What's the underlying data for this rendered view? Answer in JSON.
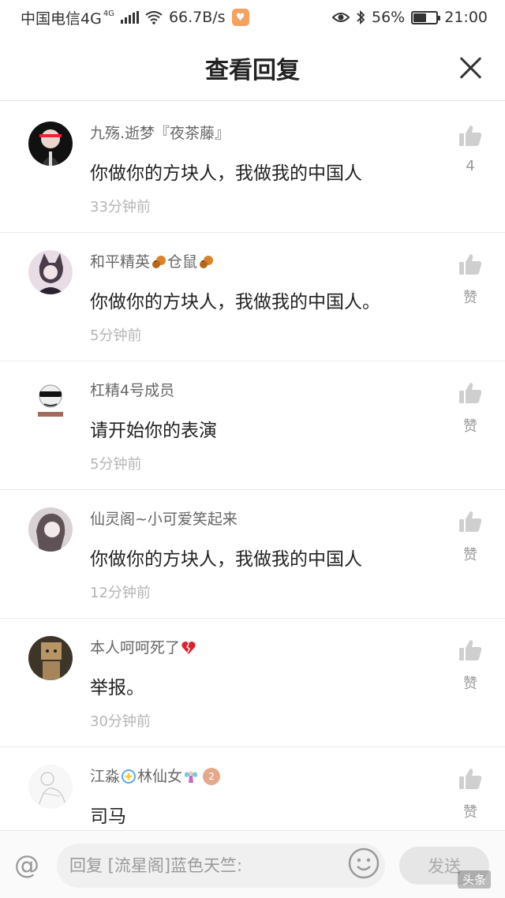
{
  "status_bar": {
    "carrier": "中国电信4G",
    "network_badge": "4G",
    "speed": "66.7B/s",
    "battery_level": "56%",
    "battery_fraction": 0.56,
    "time": "21:00"
  },
  "header": {
    "title": "查看回复"
  },
  "replies": [
    {
      "user_prefix": "九殇.逝梦『夜茶藤』",
      "user_suffix": "",
      "content": "你做你的方块人，我做我的中国人",
      "time": "33分钟前",
      "like_label": "4",
      "avatar_color": "#1a1a1a"
    },
    {
      "user_prefix": "和平精英",
      "user_mid": "仓鼠",
      "user_suffix": "",
      "content": "你做你的方块人，我做我的中国人。",
      "time": "5分钟前",
      "like_label": "赞",
      "avatar_color": "#c9b6c6"
    },
    {
      "user_prefix": "杠精4号成员",
      "user_suffix": "",
      "content": "请开始你的表演",
      "time": "5分钟前",
      "like_label": "赞",
      "avatar_color": "#ffffff"
    },
    {
      "user_prefix": "仙灵阁~小可爱笑起来",
      "user_suffix": "",
      "content": "你做你的方块人，我做我的中国人",
      "time": "12分钟前",
      "like_label": "赞",
      "avatar_color": "#8f7d80"
    },
    {
      "user_prefix": "本人呵呵死了",
      "user_suffix": "",
      "content": "举报。",
      "time": "30分钟前",
      "like_label": "赞",
      "avatar_color": "#6b5a3c"
    },
    {
      "user_prefix": "江淼",
      "user_mid": "林仙女",
      "user_suffix": "",
      "level": "2",
      "content": "司马",
      "time": "",
      "like_label": "赞",
      "avatar_color": "#f4f4f4"
    }
  ],
  "reply_bar": {
    "placeholder": "回复 [流星阁]蓝色天竺:",
    "send_label": "发送",
    "watermark": "头条"
  },
  "colors": {
    "text_primary": "#222222",
    "text_secondary": "#666666",
    "text_meta": "#b5b5b5",
    "like_icon": "#cccccc"
  }
}
